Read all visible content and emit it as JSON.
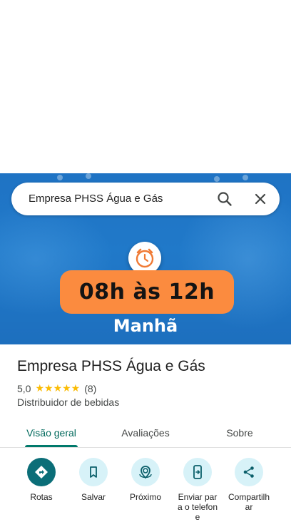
{
  "search": {
    "query": "Empresa PHSS Água e Gás"
  },
  "photo": {
    "time_range": "08h às 12h",
    "period": "Manhã"
  },
  "place": {
    "name": "Empresa PHSS Água e Gás",
    "rating": "5,0",
    "stars": "★★★★★",
    "review_count": "(8)",
    "category": "Distribuidor de bebidas"
  },
  "tabs": [
    {
      "label": "Visão geral",
      "active": true
    },
    {
      "label": "Avaliações",
      "active": false
    },
    {
      "label": "Sobre",
      "active": false
    }
  ],
  "actions": [
    {
      "label": "Rotas",
      "icon": "directions-icon"
    },
    {
      "label": "Salvar",
      "icon": "bookmark-icon"
    },
    {
      "label": "Próximo",
      "icon": "nearby-icon"
    },
    {
      "label": "Enviar para o telefone",
      "icon": "send-to-phone-icon"
    },
    {
      "label": "Compartilhar",
      "icon": "share-icon"
    }
  ],
  "colors": {
    "accent": "#00796b",
    "primary_action": "#0b6e78",
    "action_bg": "#d7f2f8",
    "star": "#fbbc04",
    "pill": "#fb8b3f",
    "photo_bg": "#1f73c4"
  }
}
